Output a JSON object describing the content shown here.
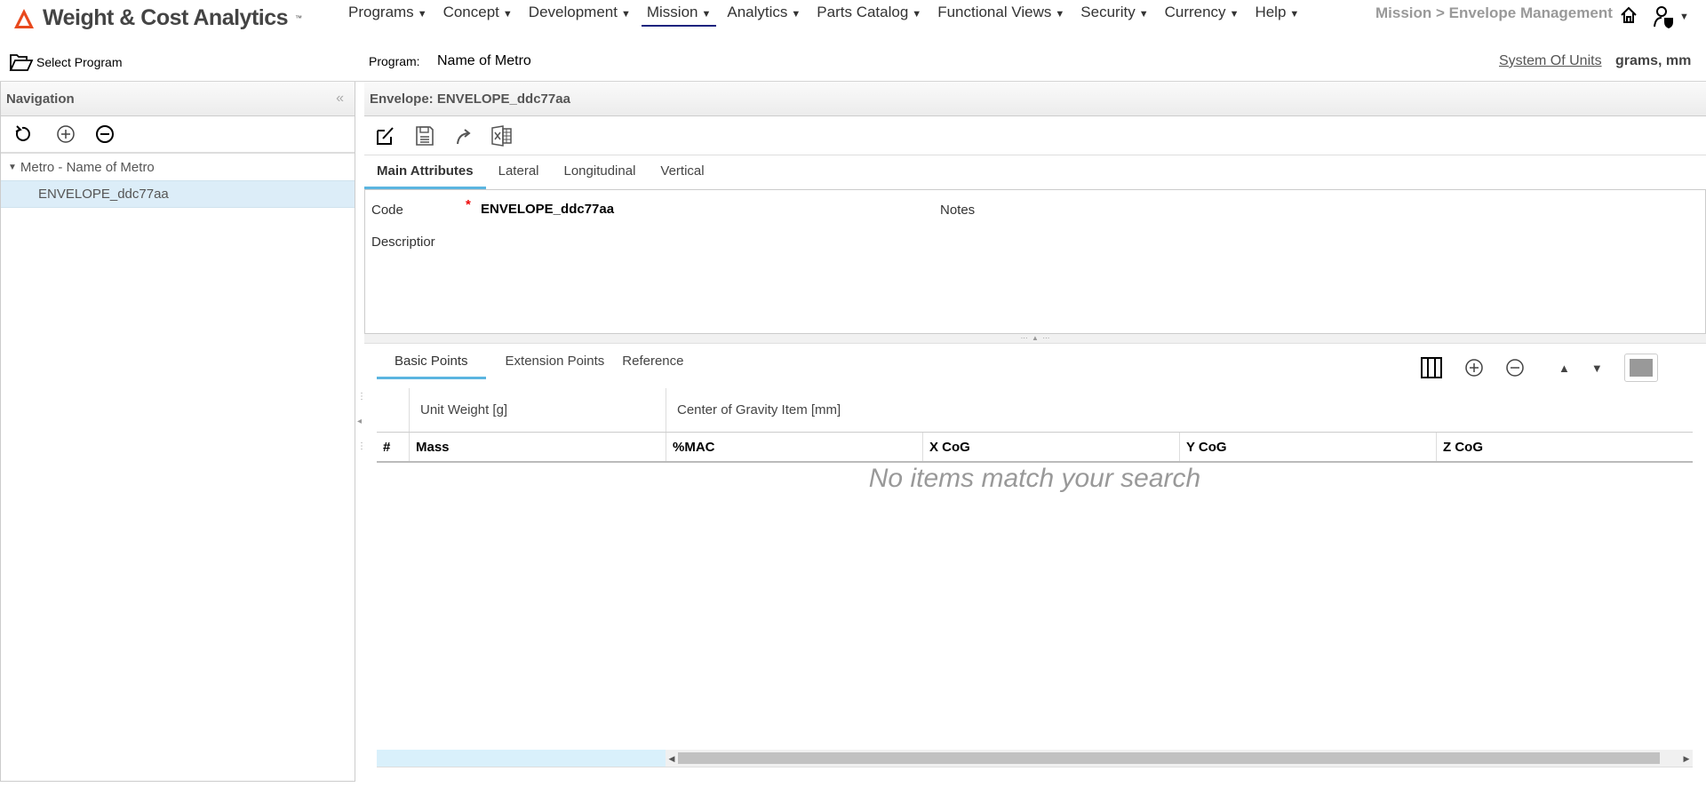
{
  "app": {
    "title": "Weight & Cost Analytics",
    "tm": "™",
    "brand_color": "#e8491d"
  },
  "menu": [
    {
      "label": "Programs"
    },
    {
      "label": "Concept"
    },
    {
      "label": "Development"
    },
    {
      "label": "Mission",
      "active": true
    },
    {
      "label": "Analytics"
    },
    {
      "label": "Parts Catalog"
    },
    {
      "label": "Functional Views"
    },
    {
      "label": "Security"
    },
    {
      "label": "Currency"
    },
    {
      "label": "Help"
    }
  ],
  "breadcrumb": "Mission > Envelope Management",
  "program_bar": {
    "select_program": "Select Program",
    "program_label": "Program:",
    "program_name": "Name of Metro",
    "units_link": "System Of Units",
    "units_value": "grams, mm"
  },
  "navigation": {
    "title": "Navigation",
    "tree": [
      {
        "label": "Metro - Name of Metro",
        "expanded": true
      },
      {
        "label": "ENVELOPE_ddc77aa",
        "selected": true
      }
    ]
  },
  "envelope": {
    "header": "Envelope: ENVELOPE_ddc77aa",
    "tabs": [
      "Main Attributes",
      "Lateral",
      "Longitudinal",
      "Vertical"
    ],
    "form": {
      "code_label": "Code",
      "required_mark": "*",
      "code_value": "ENVELOPE_ddc77aa",
      "description_label": "Descriptior",
      "notes_label": "Notes"
    }
  },
  "points": {
    "tabs": [
      "Basic Points",
      "Extension Points",
      "Reference"
    ],
    "group_headers": [
      "Unit Weight [g]",
      "Center of Gravity Item [mm]"
    ],
    "columns": [
      "#",
      "Mass",
      "%MAC",
      "X CoG",
      "Y CoG",
      "Z CoG"
    ],
    "empty_message": "No items match your search"
  }
}
